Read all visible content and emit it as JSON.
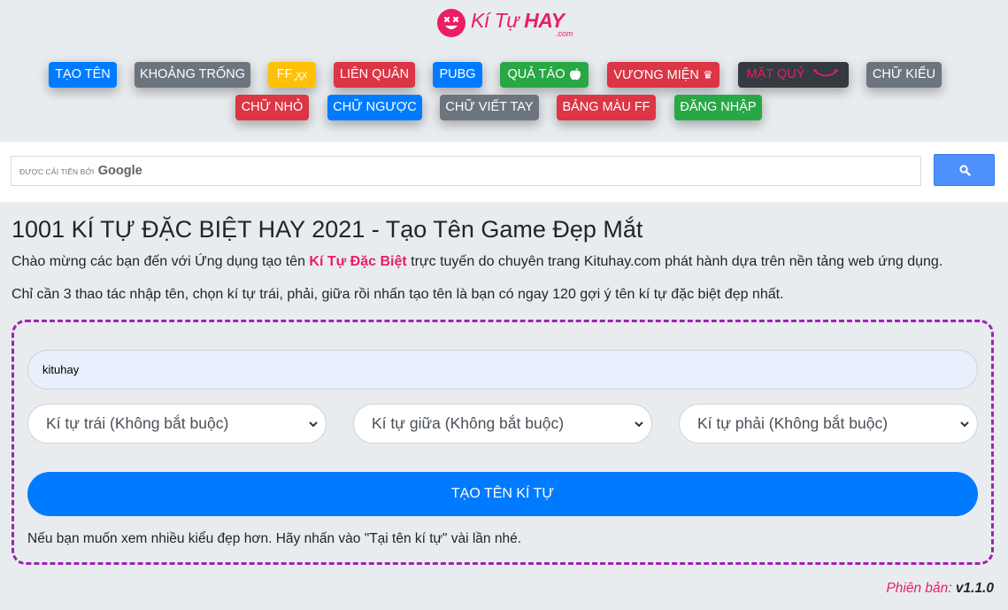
{
  "brand": {
    "logo_name": "Kí Tự ",
    "logo_bold": "HAY",
    "logo_domain": ".com",
    "primary_color": "#e91e63"
  },
  "nav": {
    "row1": [
      {
        "label": "TẠO TÊN",
        "color": "#007bff"
      },
      {
        "label": "KHOẢNG TRỐNG",
        "color": "#6c757d"
      },
      {
        "label": "FF ",
        "suffix": "ꭙꭙ",
        "color": "#ffc107"
      },
      {
        "label": "LIÊN QUÂN",
        "color": "#dc3545"
      },
      {
        "label": "PUBG",
        "color": "#007bff"
      },
      {
        "label": "QUẢ TÁO ",
        "icon": "apple-icon",
        "color": "#28a745"
      },
      {
        "label": "VƯƠNG MIỆN ",
        "suffix": "♛",
        "color": "#dc3545"
      },
      {
        "label": "MẶT QUỶ ",
        "suffix": "◡̈",
        "color": "#343a40"
      },
      {
        "label": "CHỮ KIỂU",
        "color": "#6c757d"
      }
    ],
    "row2": [
      {
        "label": "CHỮ NHỎ",
        "color": "#dc3545"
      },
      {
        "label": "CHỮ NGƯỢC",
        "color": "#007bff"
      },
      {
        "label": "CHỮ VIẾT TAY",
        "color": "#6c757d"
      },
      {
        "label": "BẢNG MÀU FF",
        "color": "#dc3545"
      },
      {
        "label": "ĐĂNG NHẬP",
        "color": "#28a745"
      }
    ]
  },
  "search": {
    "placeholder_prefix": "ĐƯỢC CẢI TIẾN BỞI",
    "placeholder_brand": "Google",
    "button_icon": "search-icon",
    "button_color": "#4d90fe"
  },
  "main": {
    "title": "1001 KÍ TỰ ĐẶC BIỆT HAY 2021 - Tạo Tên Game Đẹp Mắt",
    "intro_before": "Chào mừng các bạn đến với Ứng dụng tạo tên ",
    "intro_highlight": "Kí Tự Đặc Biệt",
    "intro_after": " trực tuyến do chuyên trang Kituhay.com phát hành dựa trên nền tảng web ứng dụng.",
    "intro2": "Chỉ cần 3 thao tác nhập tên, chọn kí tự trái, phải, giữa rồi nhấn tạo tên là bạn có ngay 120 gợi ý tên kí tự đặc biệt đẹp nhất."
  },
  "form": {
    "name_value": "kituhay",
    "select_left": "Kí tự trái (Không bắt buộc)",
    "select_middle": "Kí tự giữa (Không bắt buộc)",
    "select_right": "Kí tự phải (Không bắt buộc)",
    "submit_label": "TẠO TÊN KÍ TỰ",
    "hint": "Nếu bạn muốn xem nhiều kiểu đẹp hơn. Hãy nhấn vào \"Tại tên kí tự\" vài lần nhé."
  },
  "footer": {
    "version_label": "Phiên bản:",
    "version_value": "v1.1.0"
  }
}
